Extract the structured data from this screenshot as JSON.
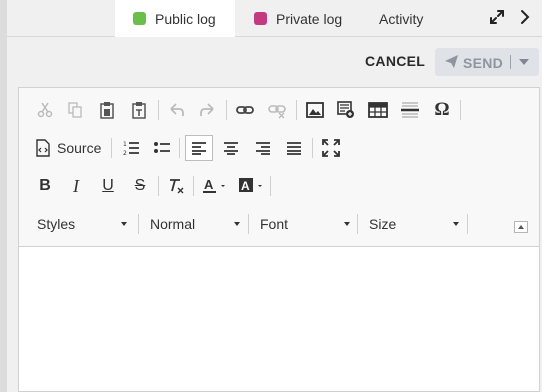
{
  "tabs": {
    "public": "Public log",
    "private": "Private log",
    "activity": "Activity",
    "public_color": "#6abf4b",
    "private_color": "#c23a80"
  },
  "actions": {
    "cancel": "CANCEL",
    "send": "SEND"
  },
  "toolbar": {
    "source_label": "Source",
    "styles_label": "Styles",
    "format_label": "Normal",
    "font_label": "Font",
    "size_label": "Size",
    "highlight_color": "#f1e300",
    "icons": [
      "cut-icon",
      "copy-icon",
      "paste-icon",
      "paste-text-icon",
      "undo-icon",
      "redo-icon",
      "link-icon",
      "unlink-icon",
      "image-icon",
      "image-gallery-icon",
      "table-icon",
      "horizontal-rule-icon",
      "special-char-icon",
      "source-icon",
      "numbered-list-icon",
      "bullet-list-icon",
      "align-left-icon",
      "align-center-icon",
      "align-right-icon",
      "justify-icon",
      "maximize-icon",
      "bold-icon",
      "italic-icon",
      "underline-icon",
      "strikethrough-icon",
      "remove-format-icon",
      "text-color-icon",
      "background-color-icon"
    ]
  }
}
